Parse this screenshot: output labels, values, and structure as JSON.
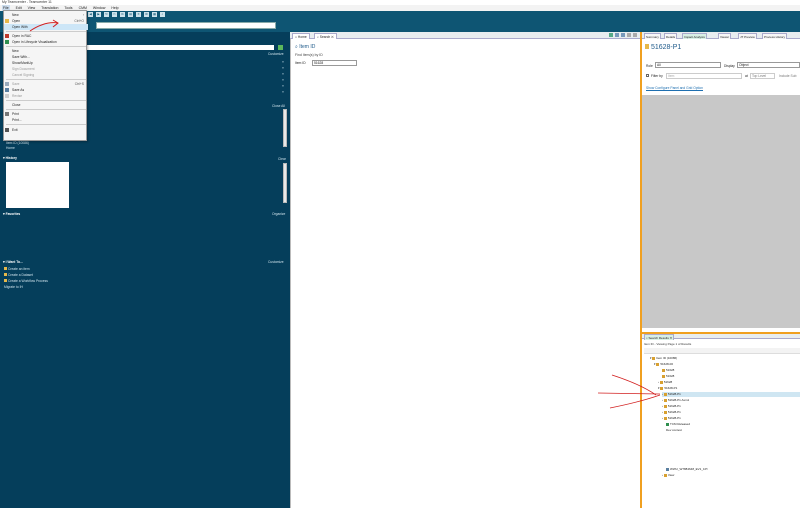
{
  "window": {
    "title": "My Teamcenter - Teamcenter 11"
  },
  "menubar": {
    "items": [
      "File",
      "Edit",
      "View",
      "Translation",
      "Tools",
      "CMM",
      "Window",
      "Help"
    ]
  },
  "file_menu": {
    "items": [
      {
        "label": "New",
        "accel": "",
        "disabled": false,
        "arrow": "›"
      },
      {
        "label": "Open",
        "accel": "Ctrl+O",
        "disabled": false
      },
      {
        "label": "Open With",
        "accel": "",
        "disabled": false,
        "selected": true
      },
      {
        "label": "Open in RAC",
        "accel": "",
        "disabled": false
      },
      {
        "label": "Open in Lifecycle Visualization",
        "accel": "",
        "disabled": false
      },
      {
        "label": "New",
        "accel": "",
        "disabled": false
      },
      {
        "label": "Save With...",
        "accel": "",
        "disabled": false
      },
      {
        "label": "Show/MarkUp",
        "accel": "",
        "disabled": false
      },
      {
        "label": "Sign Document",
        "accel": "",
        "disabled": true
      },
      {
        "label": "Cancel Signing",
        "accel": "",
        "disabled": true
      },
      {
        "label": "Save",
        "accel": "Ctrl+S",
        "disabled": true
      },
      {
        "label": "Save As",
        "accel": "",
        "disabled": false
      },
      {
        "label": "Revise",
        "accel": "",
        "disabled": true
      },
      {
        "label": "Close",
        "accel": "",
        "disabled": false
      },
      {
        "label": "Print",
        "accel": "",
        "disabled": false
      },
      {
        "label": "Print...",
        "accel": "",
        "disabled": false
      },
      {
        "label": "Exit",
        "accel": "",
        "disabled": false
      }
    ]
  },
  "left": {
    "customize1": "Customize",
    "close_all": "Close All",
    "clear": "Clear",
    "organize": "Organize",
    "customize2": "Customize",
    "recent": [
      "Item ID (10086)",
      "Home"
    ],
    "history_title": "History",
    "favorites_title": "Favorites",
    "iwant_title": "I Want To...",
    "iwant_items": [
      "Create an item",
      "Create a Dataset",
      "Create a Workflow Process",
      "Migrate to IH"
    ]
  },
  "middle": {
    "tabs": [
      "Home",
      "Search"
    ],
    "panel_title": "Item ID",
    "subtitle": "Find Item(s) by ID",
    "field_label": "Item ID",
    "field_value": "51628"
  },
  "right": {
    "tabs": [
      "Summary",
      "Details",
      "Impact Analysis",
      "Viewer",
      "JT Preview",
      "Process History"
    ],
    "object_title": "51628-P1",
    "role_label": "Role",
    "role_value": "All",
    "display_label": "Display",
    "display_value": "Object",
    "filter_label": "Filter by",
    "filter_placeholder": "Item",
    "at_label": "at",
    "top_level": "Top Level",
    "include_sub": "Include Sub",
    "config_link": "Show Configure Panel and Grid Option",
    "search_results_tab": "Search Results",
    "results_summary": "Item ID - Viewing Page 1 of Results",
    "tree": [
      "Item ID (10086)",
      "51628-00",
      "51628",
      "51628",
      "51628",
      "51628-P1",
      "51628-P1",
      "51628-P1 Asm1",
      "51628-P1",
      "51628-P1",
      "51628-P1",
      "TCM Released",
      "Dev context",
      "WWU_W7884648_EV1_1PI",
      "View"
    ]
  }
}
